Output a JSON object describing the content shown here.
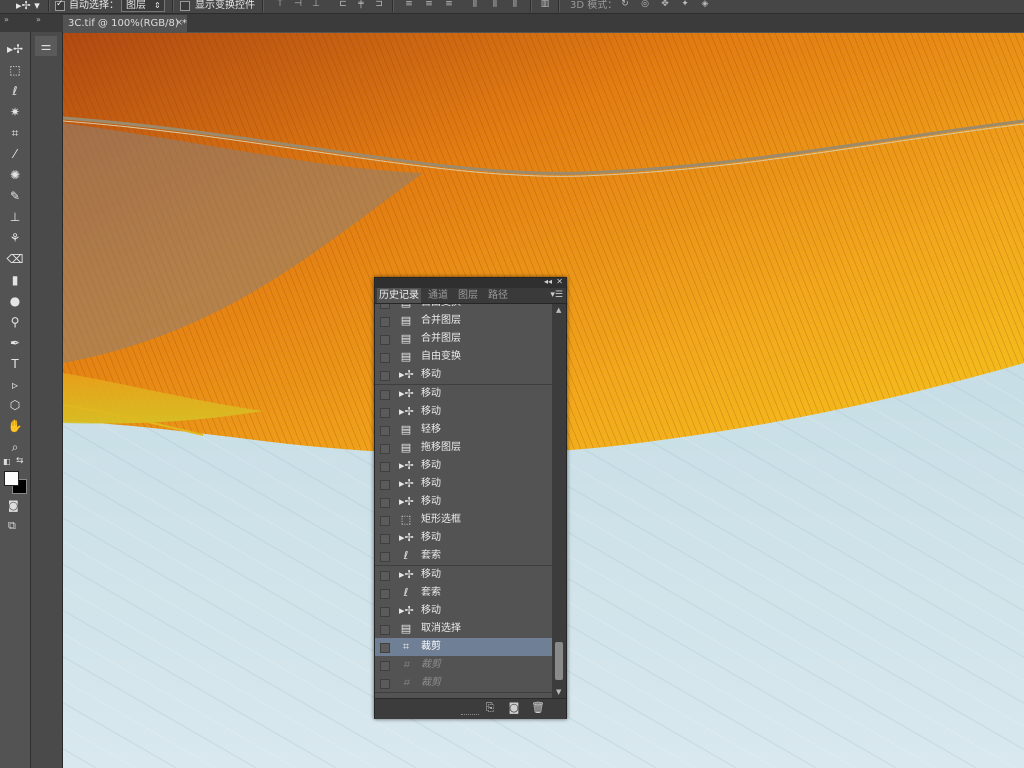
{
  "options_bar": {
    "auto_select_label": "自动选择：",
    "auto_select_checked": true,
    "auto_select_value": "图层",
    "show_transform_label": "显示变换控件",
    "show_transform_checked": false,
    "mode_3d_label": "3D 模式："
  },
  "document": {
    "tab_title": "3C.tif @ 100%(RGB/8) *",
    "close_glyph": "×"
  },
  "tools": [
    {
      "name": "move-tool-icon",
      "glyph": "▸✢"
    },
    {
      "name": "marquee-tool-icon",
      "glyph": "⬚"
    },
    {
      "name": "lasso-tool-icon",
      "glyph": "ℓ"
    },
    {
      "name": "magic-wand-tool-icon",
      "glyph": "✷"
    },
    {
      "name": "crop-tool-icon",
      "glyph": "⌗"
    },
    {
      "name": "eyedropper-tool-icon",
      "glyph": "⁄"
    },
    {
      "name": "healing-brush-tool-icon",
      "glyph": "✺"
    },
    {
      "name": "brush-tool-icon",
      "glyph": "✎"
    },
    {
      "name": "clone-stamp-tool-icon",
      "glyph": "⊥"
    },
    {
      "name": "history-brush-tool-icon",
      "glyph": "⚘"
    },
    {
      "name": "eraser-tool-icon",
      "glyph": "⌫"
    },
    {
      "name": "gradient-tool-icon",
      "glyph": "▮"
    },
    {
      "name": "blur-tool-icon",
      "glyph": "●"
    },
    {
      "name": "dodge-tool-icon",
      "glyph": "⚲"
    },
    {
      "name": "pen-tool-icon",
      "glyph": "✒"
    },
    {
      "name": "type-tool-icon",
      "glyph": "T"
    },
    {
      "name": "path-selection-tool-icon",
      "glyph": "▹"
    },
    {
      "name": "shape-tool-icon",
      "glyph": "⬡"
    },
    {
      "name": "hand-tool-icon",
      "glyph": "✋"
    },
    {
      "name": "zoom-tool-icon",
      "glyph": "⌕"
    }
  ],
  "history_panel": {
    "collapse_glyph": "◂◂",
    "close_glyph": "✕",
    "menu_glyph": "▾☰",
    "tabs": [
      {
        "label": "历史记录",
        "active": true
      },
      {
        "label": "通道",
        "active": false
      },
      {
        "label": "图层",
        "active": false
      },
      {
        "label": "路径",
        "active": false
      }
    ],
    "items": [
      {
        "label": "自由变换",
        "icon": "document-icon",
        "glyph": "▤",
        "state": "normal"
      },
      {
        "label": "合并图层",
        "icon": "document-icon",
        "glyph": "▤",
        "state": "normal"
      },
      {
        "label": "合并图层",
        "icon": "document-icon",
        "glyph": "▤",
        "state": "normal"
      },
      {
        "label": "自由变换",
        "icon": "document-icon",
        "glyph": "▤",
        "state": "normal"
      },
      {
        "label": "移动",
        "icon": "move-icon",
        "glyph": "▸✢",
        "state": "normal"
      },
      {
        "label": "移动",
        "icon": "move-icon",
        "glyph": "▸✢",
        "state": "normal"
      },
      {
        "label": "移动",
        "icon": "move-icon",
        "glyph": "▸✢",
        "state": "normal"
      },
      {
        "label": "轻移",
        "icon": "document-icon",
        "glyph": "▤",
        "state": "normal"
      },
      {
        "label": "拖移图层",
        "icon": "document-icon",
        "glyph": "▤",
        "state": "normal"
      },
      {
        "label": "移动",
        "icon": "move-icon",
        "glyph": "▸✢",
        "state": "normal"
      },
      {
        "label": "移动",
        "icon": "move-icon",
        "glyph": "▸✢",
        "state": "normal"
      },
      {
        "label": "移动",
        "icon": "move-icon",
        "glyph": "▸✢",
        "state": "normal"
      },
      {
        "label": "矩形选框",
        "icon": "marquee-icon",
        "glyph": "⬚",
        "state": "normal"
      },
      {
        "label": "移动",
        "icon": "move-icon",
        "glyph": "▸✢",
        "state": "normal"
      },
      {
        "label": "套索",
        "icon": "lasso-icon",
        "glyph": "ℓ",
        "state": "normal"
      },
      {
        "label": "移动",
        "icon": "move-icon",
        "glyph": "▸✢",
        "state": "normal"
      },
      {
        "label": "套索",
        "icon": "lasso-icon",
        "glyph": "ℓ",
        "state": "normal"
      },
      {
        "label": "移动",
        "icon": "move-icon",
        "glyph": "▸✢",
        "state": "normal"
      },
      {
        "label": "取消选择",
        "icon": "document-icon",
        "glyph": "▤",
        "state": "normal"
      },
      {
        "label": "裁剪",
        "icon": "crop-icon",
        "glyph": "⌗",
        "state": "current"
      },
      {
        "label": "裁剪",
        "icon": "crop-icon",
        "glyph": "⌗",
        "state": "undone"
      },
      {
        "label": "裁剪",
        "icon": "crop-icon",
        "glyph": "⌗",
        "state": "undone"
      }
    ],
    "footer_buttons": [
      {
        "name": "new-document-from-state-button",
        "glyph": "⎘"
      },
      {
        "name": "new-snapshot-button",
        "glyph": "◙"
      },
      {
        "name": "delete-state-button",
        "glyph": "🗑"
      }
    ]
  },
  "colors": {
    "ui_dark": "#464646",
    "panel": "#535353",
    "selected_row": "#6f7f95",
    "feather_orange": "#f0a020",
    "feather_yellow": "#f4c418",
    "background_blue": "#c9dfe6"
  }
}
